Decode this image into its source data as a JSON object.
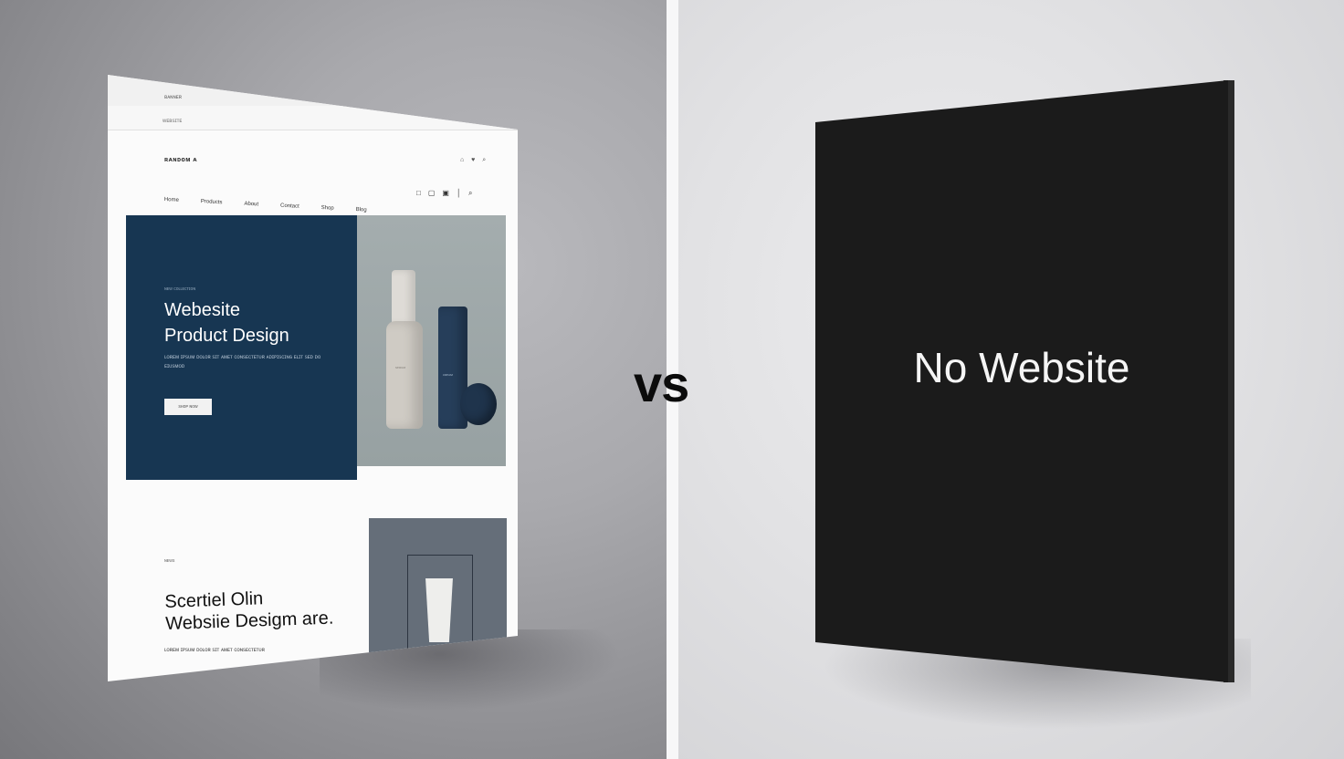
{
  "comparison_label": "vs",
  "mockup": {
    "topbar_text": "ʙᴀɴɴᴇʀ",
    "url_text": "ᴡᴇʙѕɪᴛᴇ",
    "logo": "ʀᴀɴᴅᴏᴍ ᴀ",
    "header_icons": "⌂ ♥ ⌕",
    "nav_items": [
      "Home",
      "Products",
      "About",
      "Contact",
      "Shop",
      "Blog"
    ],
    "nav_icons": [
      "□",
      "▢",
      "▣",
      "│",
      "⌕"
    ],
    "hero": {
      "kicker": "ɴᴇᴡ ᴄᴏʟʟᴇᴄᴛɪᴏɴ",
      "title_line1": "Webesite",
      "title_line2": "Product Design",
      "body": "ʟᴏʀᴇᴍ ɪᴘѕᴜᴍ ᴅᴏʟᴏʀ ѕɪᴛ ᴀᴍᴇᴛ ᴄᴏɴѕᴇᴄᴛᴇᴛᴜʀ ᴀᴅɪᴘɪѕᴄɪɴɢ ᴇʟɪᴛ ѕᴇᴅ ᴅᴏ ᴇɪᴜѕᴍᴏᴅ",
      "button": "ѕʜᴏᴘ ɴᴏᴡ"
    },
    "bottle_label": "ѕᴇʀᴜᴍ",
    "tube_label": "ᴄʀᴇᴀᴍ",
    "section": {
      "kicker": "ɴᴇᴡѕ",
      "title_line1": "Scertiel Olin",
      "title_line2": "Websiie Desigm are.",
      "body": "ʟᴏʀᴇᴍ ɪᴘѕᴜᴍ ᴅᴏʟᴏʀ ѕɪᴛ ᴀᴍᴇᴛ ᴄᴏɴѕᴇᴄᴛᴇᴛᴜʀ"
    }
  },
  "black_panel": {
    "text": "No Website"
  },
  "colors": {
    "hero_navy": "#173652",
    "panel_black": "#1b1b1b",
    "accent_gray": "#656e79"
  }
}
